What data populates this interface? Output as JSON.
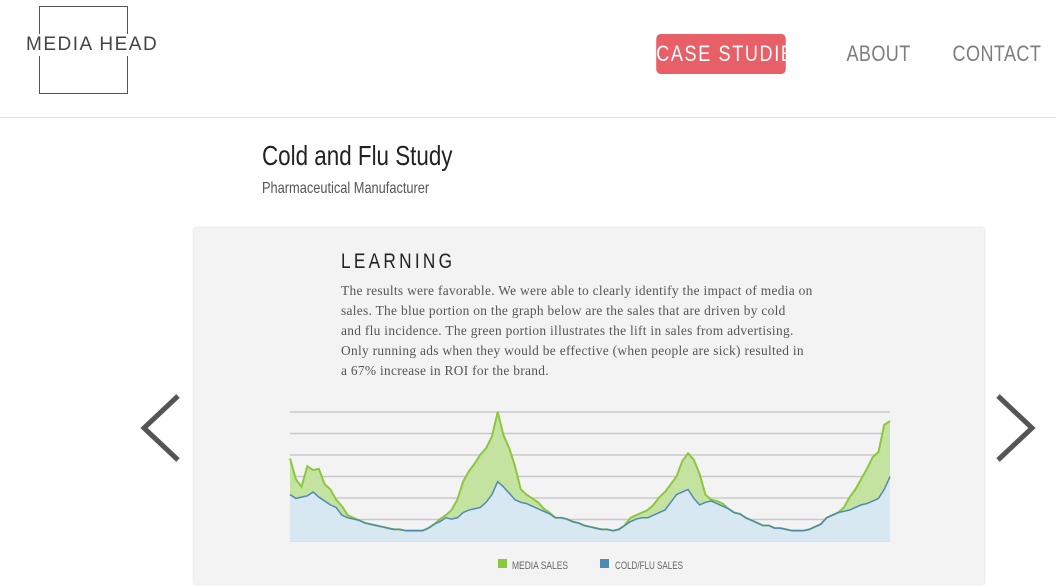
{
  "brand": {
    "logo_text": "MEDIA HEAD"
  },
  "nav": {
    "items": [
      {
        "label": "CASE STUDIES",
        "active": true
      },
      {
        "label": "ABOUT",
        "active": false
      },
      {
        "label": "CONTACT",
        "active": false
      }
    ]
  },
  "study": {
    "title": "Cold and Flu Study",
    "subtitle": "Pharmaceutical Manufacturer"
  },
  "slide": {
    "heading": "LEARNING",
    "body_lines": [
      "The results were favorable.  We were able to clearly identify the impact of media on",
      "sales.  The blue portion on the graph below are the sales that are driven by cold",
      "and flu incidence.  The green portion illustrates the lift in sales from advertising.",
      "Only running ads when they would be effective (when people are sick) resulted in",
      "a 67% increase in ROI for the brand."
    ]
  },
  "carousel": {
    "prev_icon": "chevron-left-icon",
    "next_icon": "chevron-right-icon",
    "arrow_color": "#555555"
  },
  "colors": {
    "accent": "#e85f68",
    "media_sales": "#8dc63f",
    "media_fill": "#c5e3a0",
    "cold_flu_sales": "#4f8ab3",
    "cold_flu_fill": "#d7e8f2"
  },
  "chart_data": {
    "type": "area",
    "xlabel": "",
    "ylabel": "",
    "ylim": [
      0,
      100
    ],
    "grid": true,
    "gridlines": 6,
    "legend": "bottom",
    "n_points": 121,
    "series": [
      {
        "name": "MEDIA SALES",
        "color": "#8dc63f",
        "values": [
          64,
          48,
          42,
          58,
          55,
          56,
          44,
          40,
          32,
          27,
          20,
          18,
          16,
          14,
          13,
          12,
          11,
          10,
          9,
          9,
          8,
          8,
          8,
          8,
          10,
          13,
          17,
          20,
          24,
          32,
          46,
          54,
          60,
          67,
          72,
          81,
          100,
          82,
          72,
          58,
          40,
          36,
          33,
          30,
          25,
          22,
          18,
          18,
          17,
          15,
          14,
          12,
          11,
          10,
          9,
          9,
          8,
          9,
          12,
          18,
          20,
          22,
          24,
          28,
          34,
          38,
          44,
          50,
          62,
          68,
          63,
          52,
          36,
          32,
          31,
          29,
          25,
          22,
          21,
          18,
          16,
          14,
          12,
          12,
          10,
          10,
          9,
          8,
          8,
          8,
          9,
          11,
          13,
          18,
          20,
          22,
          26,
          34,
          40,
          48,
          56,
          65,
          69,
          90,
          93
        ]
      },
      {
        "name": "COLD/FLU SALES",
        "color": "#4f8ab3",
        "values": [
          36,
          33,
          34,
          35,
          38,
          34,
          31,
          28,
          26,
          20,
          18,
          17,
          16,
          14,
          13,
          12,
          11,
          10,
          9,
          9,
          8,
          8,
          8,
          8,
          10,
          13,
          15,
          18,
          17,
          18,
          22,
          24,
          25,
          26,
          30,
          36,
          46,
          42,
          37,
          32,
          30,
          29,
          27,
          25,
          23,
          21,
          18,
          18,
          17,
          15,
          14,
          12,
          11,
          10,
          9,
          9,
          8,
          9,
          12,
          15,
          17,
          18,
          18,
          20,
          22,
          24,
          30,
          36,
          38,
          40,
          33,
          28,
          30,
          31,
          29,
          27,
          25,
          22,
          21,
          18,
          16,
          14,
          12,
          12,
          10,
          10,
          9,
          8,
          8,
          8,
          9,
          11,
          13,
          18,
          20,
          22,
          23,
          24,
          26,
          28,
          29,
          31,
          33,
          40,
          50
        ]
      }
    ]
  }
}
